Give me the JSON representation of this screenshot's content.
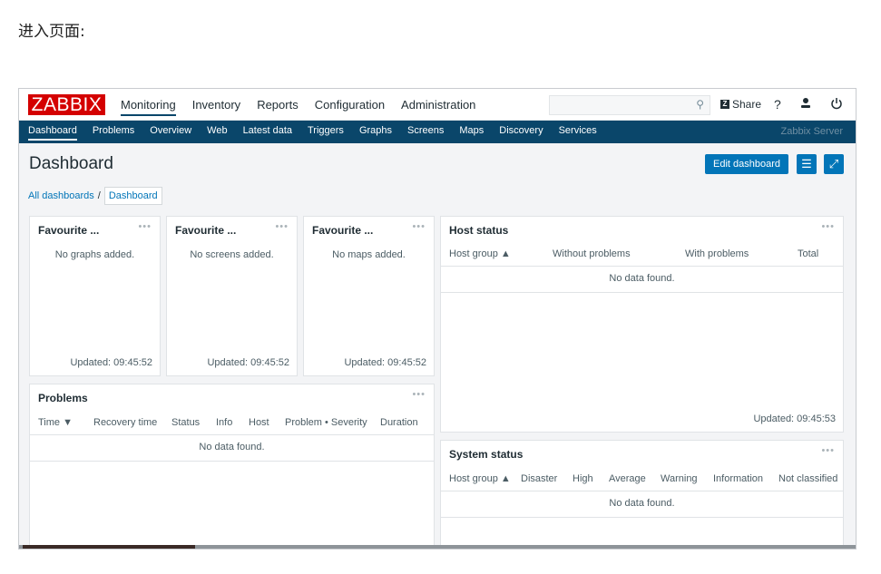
{
  "caption": "进入页面:",
  "logo": "ZABBIX",
  "main_menu": [
    "Monitoring",
    "Inventory",
    "Reports",
    "Configuration",
    "Administration"
  ],
  "search": {
    "placeholder": "",
    "icon": "search-icon"
  },
  "share_label": "Share",
  "help_glyph": "?",
  "sub_menu": [
    "Dashboard",
    "Problems",
    "Overview",
    "Web",
    "Latest data",
    "Triggers",
    "Graphs",
    "Screens",
    "Maps",
    "Discovery",
    "Services"
  ],
  "server_name": "Zabbix Server",
  "page_title": "Dashboard",
  "edit_dashboard_label": "Edit dashboard",
  "breadcrumb": {
    "all": "All dashboards",
    "sep": "/",
    "current": "Dashboard"
  },
  "widgets": {
    "fav_graphs": {
      "title": "Favourite ...",
      "message": "No graphs added.",
      "updated": "Updated: 09:45:52"
    },
    "fav_screens": {
      "title": "Favourite ...",
      "message": "No screens added.",
      "updated": "Updated: 09:45:52"
    },
    "fav_maps": {
      "title": "Favourite ...",
      "message": "No maps added.",
      "updated": "Updated: 09:45:52"
    },
    "host_status": {
      "title": "Host status",
      "columns": [
        "Host group ▲",
        "Without problems",
        "With problems",
        "Total"
      ],
      "nodata": "No data found.",
      "updated": "Updated: 09:45:53"
    },
    "problems": {
      "title": "Problems",
      "columns": [
        "Time ▼",
        "Recovery time",
        "Status",
        "Info",
        "Host",
        "Problem • Severity",
        "Duration"
      ],
      "nodata": "No data found."
    },
    "system_status": {
      "title": "System status",
      "columns": [
        "Host group ▲",
        "Disaster",
        "High",
        "Average",
        "Warning",
        "Information",
        "Not classified"
      ],
      "nodata": "No data found."
    }
  },
  "dots": "•••",
  "colors": {
    "brand": "#d40000",
    "nav": "#0a466a",
    "button": "#0275b8"
  }
}
